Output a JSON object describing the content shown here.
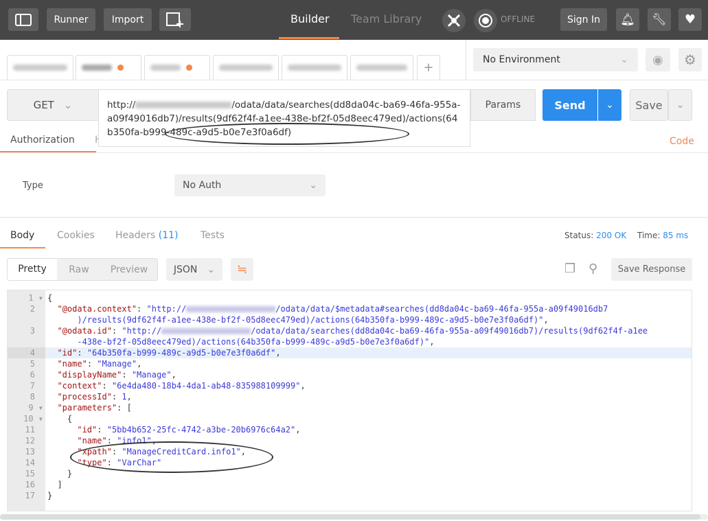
{
  "header": {
    "runner": "Runner",
    "import": "Import",
    "builder": "Builder",
    "team_library": "Team Library",
    "offline": "OFFLINE",
    "sign_in": "Sign In",
    "accent": "#f4884a"
  },
  "environment": {
    "selected": "No Environment"
  },
  "request": {
    "method": "GET",
    "url_prefix": "http://",
    "url_rest": "/odata/data/searches(dd8da04c-ba69-46fa-955a-a09f49016db7)/results(9df62f4f-a1ee-438e-bf2f-05d8eec479ed)/actions(64b350fa-b999-489c-a9d5-b0e7e3f0a6df)",
    "params": "Params",
    "send": "Send",
    "save": "Save",
    "send_color": "#2c8ded"
  },
  "req_tabs": {
    "authorization": "Authorization",
    "headers_partial": "H",
    "code": "Code"
  },
  "auth": {
    "type_label": "Type",
    "type_value": "No Auth"
  },
  "response": {
    "tabs": [
      "Body",
      "Cookies",
      "Headers",
      "Tests"
    ],
    "headers_count": "(11)",
    "status_label": "Status:",
    "status_value": "200 OK",
    "time_label": "Time:",
    "time_value": "85 ms",
    "formats": [
      "Pretty",
      "Raw",
      "Preview"
    ],
    "language": "JSON",
    "save_response": "Save Response"
  },
  "code_lines": [
    {
      "n": "1",
      "html": "{",
      "fold": true
    },
    {
      "n": "2",
      "html": "  <span class=k>\"@odata.context\"</span>: <span class=s>\"http://<span class=blurred></span>/odata/data/$metadata#searches(dd8da04c-ba69-46fa-955a-a09f49016db7</span>"
    },
    {
      "n": "",
      "html": "      <span class=s>)/results(9df62f4f-a1ee-438e-bf2f-05d8eec479ed)/actions(64b350fa-b999-489c-a9d5-b0e7e3f0a6df)\"</span>,"
    },
    {
      "n": "3",
      "html": "  <span class=k>\"@odata.id\"</span>: <span class=s>\"http://<span class=blurred></span>/odata/data/searches(dd8da04c-ba69-46fa-955a-a09f49016db7)/results(9df62f4f-a1ee</span>"
    },
    {
      "n": "",
      "html": "      <span class=s>-438e-bf2f-05d8eec479ed)/actions(64b350fa-b999-489c-a9d5-b0e7e3f0a6df)\"</span>,"
    },
    {
      "n": "4",
      "html": "  <span class=k>\"id\"</span>: <span class=s>\"64b350fa-b999-489c-a9d5-b0e7e3f0a6df\"</span>,",
      "hl": true
    },
    {
      "n": "5",
      "html": "  <span class=k>\"name\"</span>: <span class=s>\"Manage\"</span>,"
    },
    {
      "n": "6",
      "html": "  <span class=k>\"displayName\"</span>: <span class=s>\"Manage\"</span>,"
    },
    {
      "n": "7",
      "html": "  <span class=k>\"context\"</span>: <span class=s>\"6e4da480-18b4-4da1-ab48-835988109999\"</span>,"
    },
    {
      "n": "8",
      "html": "  <span class=k>\"processId\"</span>: <span class=n>1</span>,"
    },
    {
      "n": "9",
      "html": "  <span class=k>\"parameters\"</span>: [",
      "fold": true
    },
    {
      "n": "10",
      "html": "    {",
      "fold": true
    },
    {
      "n": "11",
      "html": "      <span class=k>\"id\"</span>: <span class=s>\"5bb4b652-25fc-4742-a3be-20b6976c64a2\"</span>,"
    },
    {
      "n": "12",
      "html": "      <span class=k>\"name\"</span>: <span class=s>\"info1\"</span>,"
    },
    {
      "n": "13",
      "html": "      <span class=k>\"xpath\"</span>: <span class=s>\"ManageCreditCard.info1\"</span>,"
    },
    {
      "n": "14",
      "html": "      <span class=k>\"type\"</span>: <span class=s>\"VarChar\"</span>"
    },
    {
      "n": "15",
      "html": "    }"
    },
    {
      "n": "16",
      "html": "  ]"
    },
    {
      "n": "17",
      "html": "}"
    }
  ]
}
